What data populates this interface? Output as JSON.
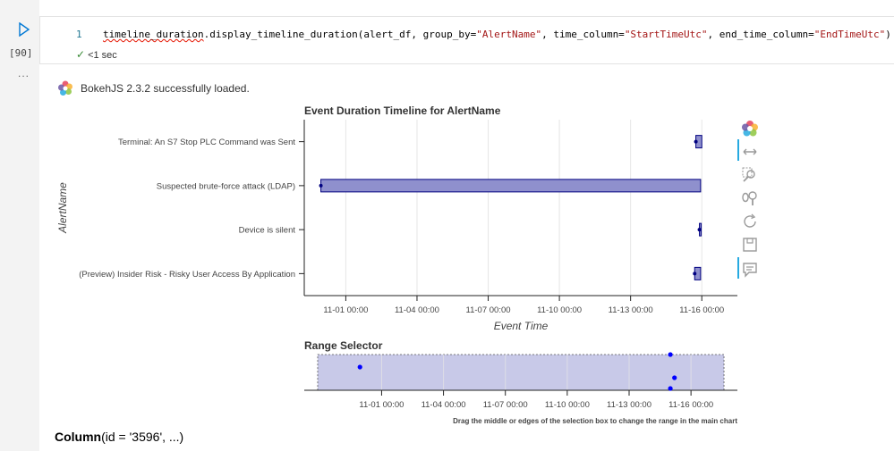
{
  "cell": {
    "execution_count": "[90]",
    "line_number": "1",
    "code": {
      "squiggled": "timeline_duration",
      "part1": ".display_timeline_duration(alert_df, group_by=",
      "str1": "\"AlertName\"",
      "part2": ", time_column=",
      "str2": "\"StartTimeUtc\"",
      "part3": ", end_time_column=",
      "str3": "\"EndTimeUtc\"",
      "part4": ")"
    },
    "status": "<1 sec",
    "more": "..."
  },
  "output": {
    "bokeh_message": "BokehJS 2.3.2 successfully loaded.",
    "column_repr": {
      "name": "Column",
      "args": "(id = '3596', ...)"
    }
  },
  "chart_data": [
    {
      "type": "bar",
      "orientation": "horizontal-timeline",
      "title": "Event Duration Timeline for AlertName",
      "xlabel": "Event Time",
      "ylabel": "AlertName",
      "x_ticks": [
        "11-01 00:00",
        "11-04 00:00",
        "11-07 00:00",
        "11-10 00:00",
        "11-13 00:00",
        "11-16 00:00"
      ],
      "x_tick_values": [
        1,
        4,
        7,
        10,
        13,
        16
      ],
      "xlim": [
        -0.75,
        17.5
      ],
      "grid": true,
      "bar_color": "#8f90cd",
      "edge_color": "#000080",
      "categories": [
        "Terminal: An S7 Stop PLC Command was Sent",
        "Suspected brute-force attack (LDAP)",
        "Device is silent",
        "(Preview) Insider Risk - Risky User Access By Application"
      ],
      "series": [
        {
          "start": [
            15.75,
            -0.05,
            15.9,
            15.7
          ],
          "end": [
            16.0,
            15.95,
            15.95,
            15.95
          ]
        }
      ]
    },
    {
      "type": "scatter",
      "title": "Range Selector",
      "x_ticks": [
        "11-01 00:00",
        "11-04 00:00",
        "11-07 00:00",
        "11-10 00:00",
        "11-13 00:00",
        "11-16 00:00"
      ],
      "x_tick_values": [
        1,
        4,
        7,
        10,
        13,
        16
      ],
      "xlim": [
        -2.75,
        18.25
      ],
      "x": [
        -0.05,
        15.0,
        15.2,
        15.0
      ],
      "y": [
        0.65,
        1.0,
        0.35,
        0.05
      ],
      "point_color": "#0000ff",
      "selection_range": [
        -2.1,
        17.6
      ],
      "selection_color": "#c8c9e8",
      "footnote": "Drag the middle or edges of the selection box to change the range in the main chart"
    }
  ],
  "toolbar": {
    "tools": [
      "bokeh-logo-icon",
      "pan-icon",
      "box-zoom-icon",
      "wheel-zoom-icon",
      "reset-icon",
      "save-icon",
      "hover-icon"
    ]
  }
}
